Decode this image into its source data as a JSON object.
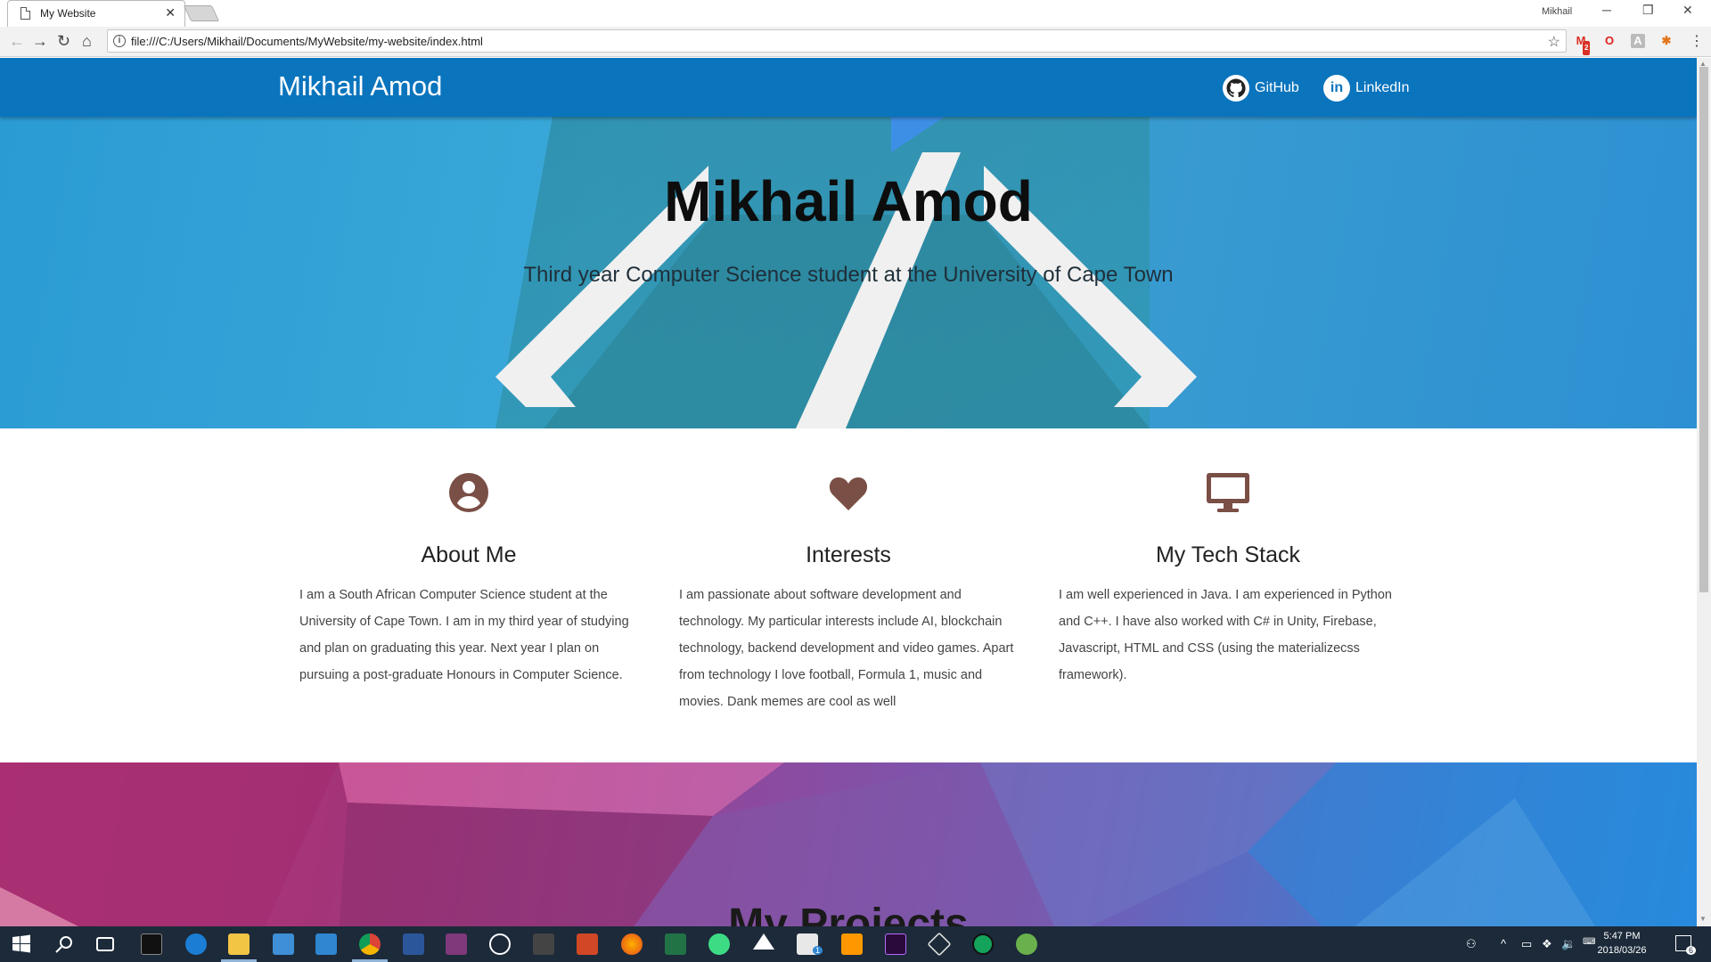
{
  "browser": {
    "tab_title": "My Website",
    "tab_close": "✕",
    "window_user": "Mikhail",
    "win_minimize": "─",
    "win_restore": "❐",
    "win_close": "✕",
    "url": "file:///C:/Users/Mikhail/Documents/MyWebsite/my-website/index.html",
    "back": "←",
    "forward": "→",
    "reload": "↻",
    "home": "⌂",
    "bookmark_star": "☆",
    "info": "i",
    "menu": "⋮",
    "gmail_badge": "2"
  },
  "site": {
    "brand": "Mikhail Amod",
    "nav": [
      {
        "label": "GitHub",
        "icon": "github-icon"
      },
      {
        "label": "LinkedIn",
        "icon": "linkedin-icon",
        "glyph": "in"
      }
    ],
    "hero_title": "Mikhail Amod",
    "hero_subtitle": "Third year Computer Science student at the University of Cape Town",
    "features": [
      {
        "icon": "account-circle-icon",
        "title": "About Me",
        "text": "I am a South African Computer Science student at the University of Cape Town. I am in my third year of studying and plan on graduating this year. Next year I plan on pursuing a post-graduate Honours in Computer Science."
      },
      {
        "icon": "heart-icon",
        "title": "Interests",
        "text": "I am passionate about software development and technology. My particular interests include AI, blockchain technology, backend development and video games. Apart from technology I love football, Formula 1, music and movies. Dank memes are cool as well"
      },
      {
        "icon": "desktop-monitor-icon",
        "title": "My Tech Stack",
        "text": "I am well experienced in Java. I am experienced in Python and C++. I have also worked with C# in Unity, Firebase, Javascript, HTML and CSS (using the materializecss framework)."
      }
    ],
    "projects_title": "My Projects",
    "colors": {
      "nav_blue": "#0a74bd",
      "icon_brown": "#7a4f45"
    }
  },
  "taskbar": {
    "time": "5:47 PM",
    "date": "2018/03/26",
    "notification_count": "6",
    "mail_badge": "1"
  }
}
